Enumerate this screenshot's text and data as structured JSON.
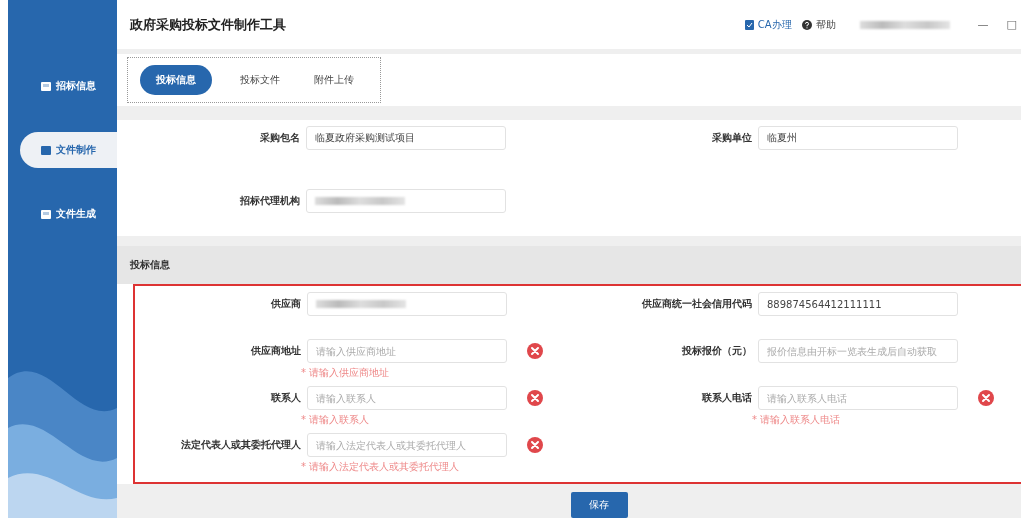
{
  "sidebar": {
    "items": [
      {
        "label": "招标信息",
        "selected": false
      },
      {
        "label": "文件制作",
        "selected": true
      },
      {
        "label": "文件生成",
        "selected": false
      }
    ]
  },
  "header": {
    "title": "政府采购投标文件制作工具",
    "actions": [
      {
        "kind": "ca",
        "label": "CA办理"
      },
      {
        "kind": "help",
        "label": "帮助"
      }
    ],
    "window_controls": [
      "—",
      "□"
    ]
  },
  "tabs": [
    {
      "label": "投标信息",
      "selected": true
    },
    {
      "label": "投标文件",
      "selected": false
    },
    {
      "label": "附件上传",
      "selected": false
    }
  ],
  "project": {
    "fields": [
      {
        "label": "采购包名",
        "kind": "text",
        "value": "临夏政府采购测试项目"
      },
      {
        "label": "采购单位",
        "kind": "text",
        "value": "临夏州"
      },
      {
        "label": "招标代理机构",
        "kind": "redacted"
      }
    ]
  },
  "bid": {
    "title": "投标信息",
    "fields": [
      {
        "label": "供应商",
        "kind": "redacted",
        "error": false
      },
      {
        "label": "供应商统一社会信用代码",
        "kind": "text",
        "value": "889874564412111111",
        "error": false
      },
      {
        "label": "供应商地址",
        "kind": "text",
        "placeholder": "请输入供应商地址",
        "error": true,
        "hint": "* 请输入供应商地址"
      },
      {
        "label": "投标报价（元）",
        "kind": "text",
        "placeholder": "报价信息由开标一览表生成后自动获取",
        "error": false
      },
      {
        "label": "联系人",
        "kind": "text",
        "placeholder": "请输入联系人",
        "error": true,
        "hint": "* 请输入联系人"
      },
      {
        "label": "联系人电话",
        "kind": "text",
        "placeholder": "请输入联系人电话",
        "error": true,
        "hint": "* 请输入联系人电话"
      },
      {
        "label": "法定代表人或其委托代理人",
        "kind": "text",
        "placeholder": "请输入法定代表人或其委托代理人",
        "error": true,
        "hint": "* 请输入法定代表人或其委托代理人"
      }
    ]
  },
  "save_button": "保存"
}
